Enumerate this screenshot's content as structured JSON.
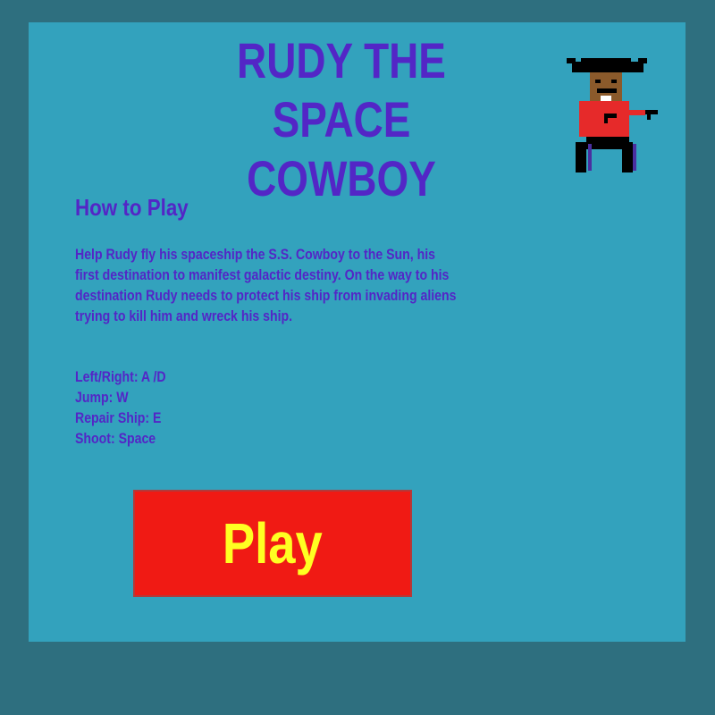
{
  "title": {
    "line1": "RUDY THE SPACE",
    "line2": "COWBOY"
  },
  "how_to_play": {
    "heading": "How to Play",
    "description": "Help Rudy fly his spaceship the S.S. Cowboy to the Sun, his first destination to manifest galactic destiny. On the way to his destination Rudy needs to protect his ship from invading aliens trying to kill him and wreck his ship."
  },
  "controls": [
    "Left/Right: A /D",
    "Jump: W",
    "Repair Ship: E",
    "Shoot: Space"
  ],
  "play_button": {
    "label": "Play"
  },
  "character": {
    "icon": "cowboy-sprite-icon"
  },
  "colors": {
    "background": "#2e6f7f",
    "panel": "#33a2bd",
    "text": "#5326c6",
    "button": "#f01a14",
    "button_text": "#ffff22"
  }
}
